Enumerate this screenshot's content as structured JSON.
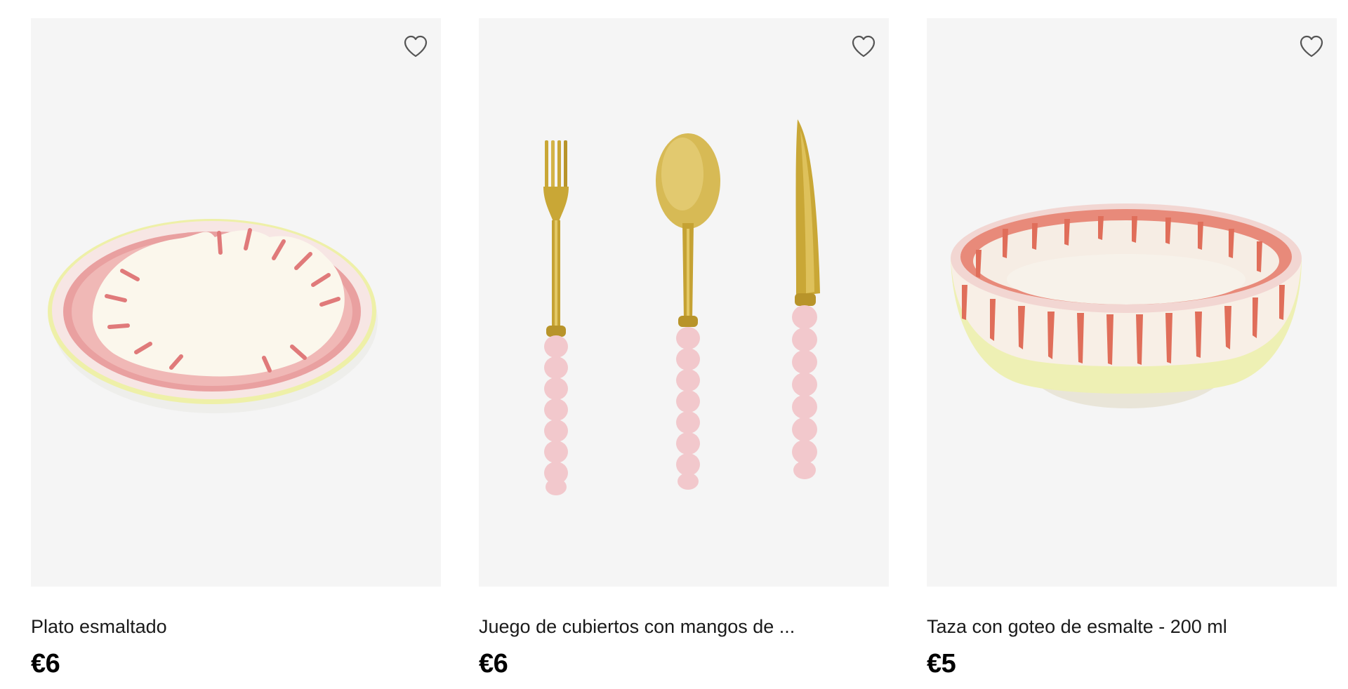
{
  "products": [
    {
      "name": "Plato esmaltado",
      "price": "€6",
      "image_icon": "enamel-plate-image",
      "favorite_icon": "heart-outline-icon"
    },
    {
      "name": "Juego de cubiertos con mangos de ...",
      "price": "€6",
      "image_icon": "cutlery-set-image",
      "favorite_icon": "heart-outline-icon"
    },
    {
      "name": "Taza con goteo de esmalte - 200 ml",
      "price": "€5",
      "image_icon": "drip-glaze-cup-image",
      "favorite_icon": "heart-outline-icon"
    }
  ],
  "colors": {
    "card_background": "#f5f5f5",
    "glaze_pink": "#e58a8a",
    "glaze_red": "#d9503c",
    "rim_yellow": "#eef0a8",
    "cream": "#faf6ec",
    "gold": "#c9a736",
    "handle_pink": "#f2c8cc"
  }
}
